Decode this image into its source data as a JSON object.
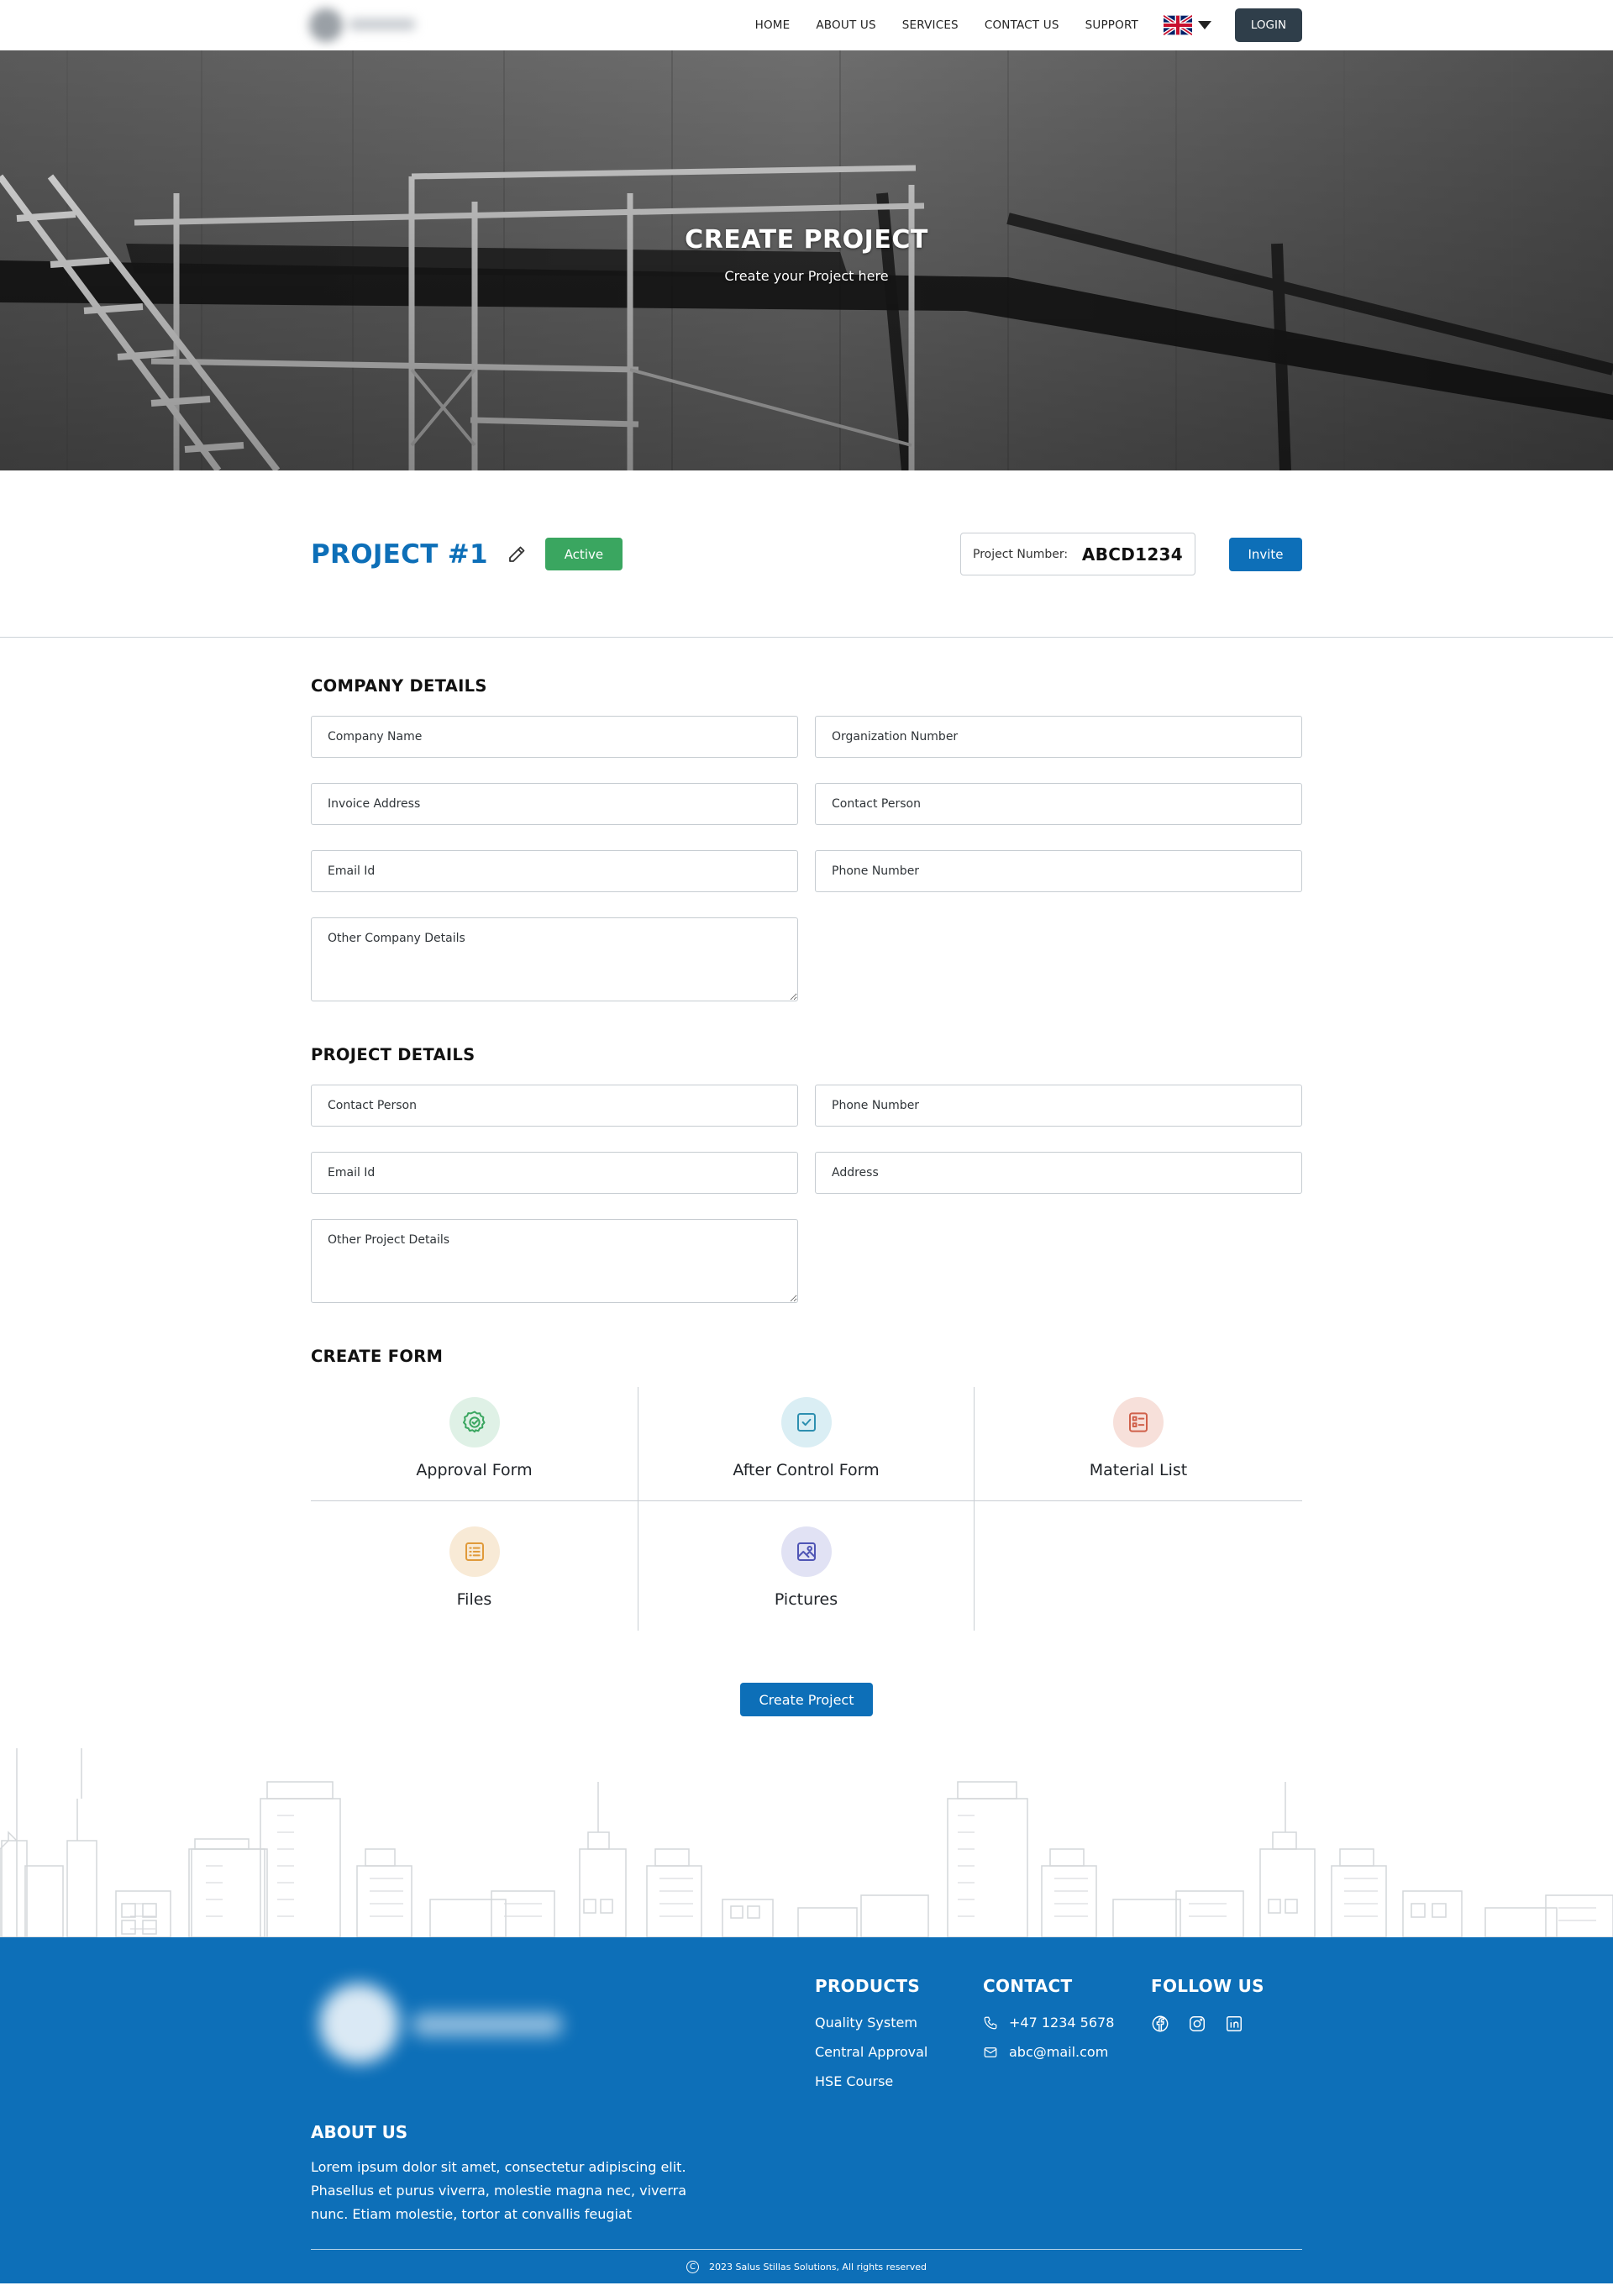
{
  "nav": {
    "links": [
      "HOME",
      "ABOUT US",
      "SERVICES",
      "CONTACT US",
      "SUPPORT"
    ],
    "login_label": "LOGIN",
    "language_icon": "uk-flag-icon"
  },
  "hero": {
    "title": "CREATE PROJECT",
    "subtitle": "Create your Project here"
  },
  "project": {
    "title": "PROJECT #1",
    "status": "Active",
    "number_label": "Project Number:",
    "number_value": "ABCD1234",
    "invite_label": "Invite"
  },
  "company": {
    "title": "COMPANY DETAILS",
    "fields": [
      "Company Name",
      "Organization Number",
      "Invoice Address",
      "Contact Person",
      "Email Id",
      "Phone Number"
    ],
    "other": "Other Company Details"
  },
  "project_details": {
    "title": "PROJECT DETAILS",
    "fields": [
      "Contact Person",
      "Phone Number",
      "Email Id",
      "Address"
    ],
    "other": "Other Project Details"
  },
  "create_form": {
    "title": "CREATE FORM",
    "cards": [
      {
        "label": "Approval Form",
        "icon": "badge-check-icon",
        "color": "#3aa660",
        "bg": "#dff1e6"
      },
      {
        "label": "After Control Form",
        "icon": "checkbox-icon",
        "color": "#2d8fb0",
        "bg": "#daeef4"
      },
      {
        "label": "Material List",
        "icon": "list-icon",
        "color": "#d0604a",
        "bg": "#f7e0da"
      },
      {
        "label": "Files",
        "icon": "file-list-icon",
        "color": "#e09a3a",
        "bg": "#f8ead6"
      },
      {
        "label": "Pictures",
        "icon": "image-icon",
        "color": "#4f55b5",
        "bg": "#e1e2f4"
      }
    ],
    "submit_label": "Create Project"
  },
  "footer": {
    "products_title": "PRODUCTS",
    "products": [
      "Quality System",
      "Central Approval",
      "HSE Course"
    ],
    "contact_title": "CONTACT",
    "phone": "+47 1234 5678",
    "email": "abc@mail.com",
    "follow_title": "FOLLOW US",
    "socials": [
      "facebook-icon",
      "instagram-icon",
      "linkedin-icon"
    ],
    "about_title": "ABOUT US",
    "about_text": "Lorem ipsum dolor sit amet, consectetur adipiscing elit. Phasellus et purus viverra, molestie magna nec, viverra nunc. Etiam molestie, tortor at convallis feugiat",
    "copyright": "2023 Salus Stillas Solutions, All rights reserved",
    "copyright_icon": "copyright-icon"
  },
  "colors": {
    "primary": "#0d6fb8",
    "active": "#3aa660",
    "dark": "#2f3e4a"
  }
}
